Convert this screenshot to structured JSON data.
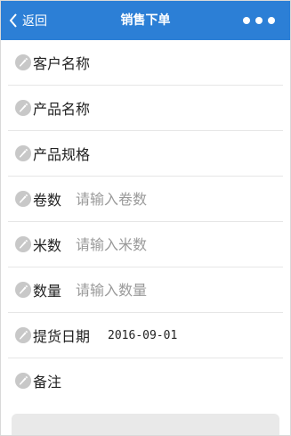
{
  "header": {
    "back_label": "返回",
    "title": "销售下单",
    "bg_color": "#2c7fd6"
  },
  "form": {
    "customer": {
      "label": "客户名称"
    },
    "product": {
      "label": "产品名称"
    },
    "spec": {
      "label": "产品规格"
    },
    "rolls": {
      "label": "卷数",
      "placeholder": "请输入卷数"
    },
    "meters": {
      "label": "米数",
      "placeholder": "请输入米数"
    },
    "quantity": {
      "label": "数量",
      "placeholder": "请输入数量"
    },
    "pickup_date": {
      "label": "提货日期",
      "value": "2016-09-01"
    },
    "remark": {
      "label": "备注"
    }
  },
  "icons": {
    "row_icon": "pencil-icon",
    "back_icon": "chevron-left-icon",
    "more_icon": "more-dots-icon"
  }
}
